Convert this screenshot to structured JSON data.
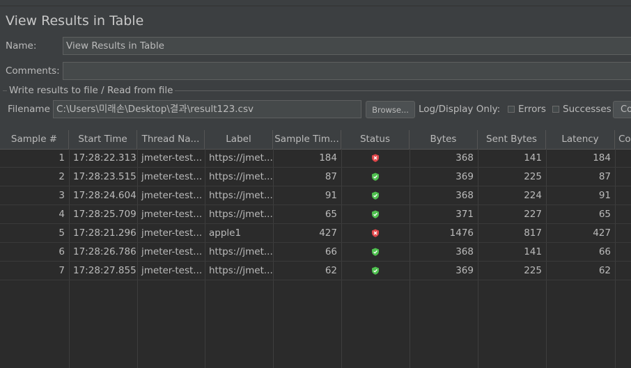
{
  "window": {
    "title": "View Results in Table"
  },
  "form": {
    "name_label": "Name:",
    "name_value": "View Results in Table",
    "comments_label": "Comments:",
    "comments_value": "",
    "group_title": "Write results to file / Read from file",
    "filename_label": "Filename",
    "filename_value": "C:\\Users\\미래손\\Desktop\\결과\\result123.csv",
    "browse_label": "Browse...",
    "log_display_label": "Log/Display Only:",
    "errors_label": "Errors",
    "successes_label": "Successes",
    "configure_label": "Co"
  },
  "table": {
    "columns": [
      "Sample #",
      "Start Time",
      "Thread Na...",
      "Label",
      "Sample Tim...",
      "Status",
      "Bytes",
      "Sent Bytes",
      "Latency",
      "Co"
    ],
    "rows": [
      {
        "sample": "1",
        "start": "17:28:22.313",
        "thread": "jmeter-test...",
        "label": "https://jmet...",
        "time": "184",
        "status": "error",
        "bytes": "368",
        "sent": "141",
        "latency": "184"
      },
      {
        "sample": "2",
        "start": "17:28:23.515",
        "thread": "jmeter-test...",
        "label": "https://jmet...",
        "time": "87",
        "status": "success",
        "bytes": "369",
        "sent": "225",
        "latency": "87"
      },
      {
        "sample": "3",
        "start": "17:28:24.604",
        "thread": "jmeter-test...",
        "label": "https://jmet...",
        "time": "91",
        "status": "success",
        "bytes": "368",
        "sent": "224",
        "latency": "91"
      },
      {
        "sample": "4",
        "start": "17:28:25.709",
        "thread": "jmeter-test...",
        "label": "https://jmet...",
        "time": "65",
        "status": "success",
        "bytes": "371",
        "sent": "227",
        "latency": "65"
      },
      {
        "sample": "5",
        "start": "17:28:21.296",
        "thread": "jmeter-test...",
        "label": "apple1",
        "time": "427",
        "status": "error",
        "bytes": "1476",
        "sent": "817",
        "latency": "427"
      },
      {
        "sample": "6",
        "start": "17:28:26.786",
        "thread": "jmeter-test...",
        "label": "https://jmet...",
        "time": "66",
        "status": "success",
        "bytes": "368",
        "sent": "141",
        "latency": "66"
      },
      {
        "sample": "7",
        "start": "17:28:27.855",
        "thread": "jmeter-test...",
        "label": "https://jmet...",
        "time": "62",
        "status": "success",
        "bytes": "369",
        "sent": "225",
        "latency": "62"
      }
    ]
  },
  "icons": {
    "error": "shield-error-icon",
    "success": "shield-success-icon"
  },
  "colors": {
    "error": "#e0474a",
    "success": "#4fc04f",
    "background": "#3c3f41",
    "table_bg": "#2b2b2b"
  }
}
